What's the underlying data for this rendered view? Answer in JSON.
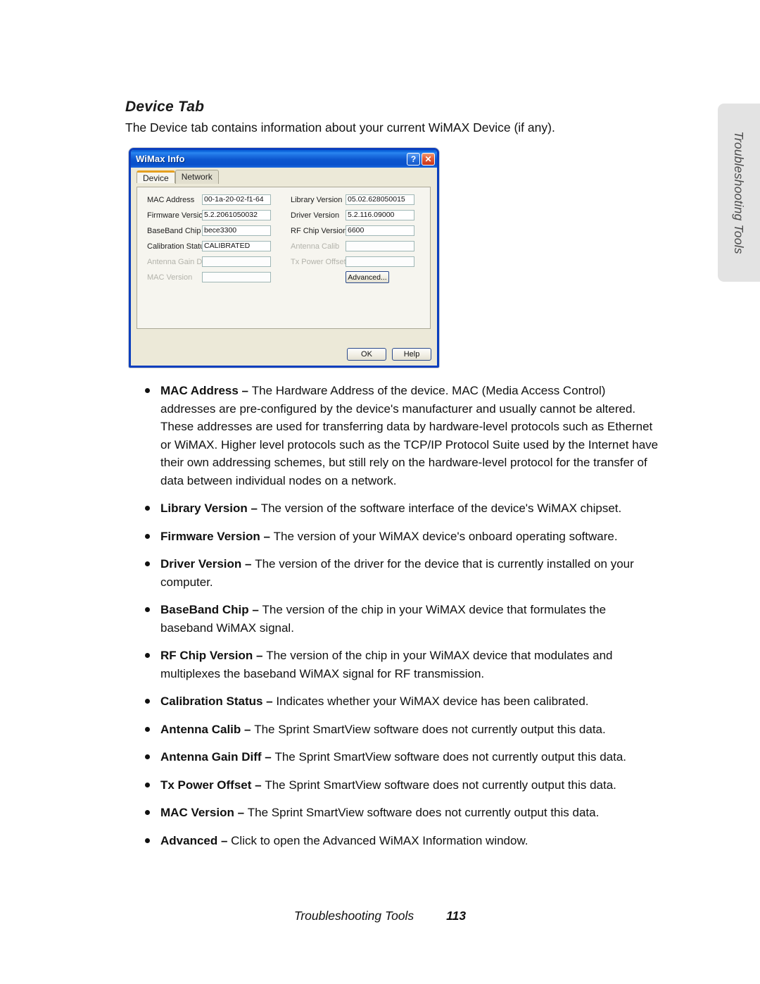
{
  "page": {
    "section_title": "Device Tab",
    "intro": "The Device tab contains information about your current WiMAX Device (if any).",
    "side_tab_label": "Troubleshooting Tools",
    "footer_chapter": "Troubleshooting Tools",
    "footer_page": "113"
  },
  "dialog": {
    "title": "WiMax Info",
    "help_button": "?",
    "close_button": "✕",
    "tabs": [
      {
        "label": "Device",
        "active": true
      },
      {
        "label": "Network",
        "active": false
      }
    ],
    "fields_left": [
      {
        "label": "MAC Address",
        "value": "00-1a-20-02-f1-64",
        "disabled": false
      },
      {
        "label": "Firmware Version",
        "value": "5.2.2061050032",
        "disabled": false
      },
      {
        "label": "BaseBand Chip",
        "value": "bece3300",
        "disabled": false
      },
      {
        "label": "Calibration Status",
        "value": "CALIBRATED",
        "disabled": false
      },
      {
        "label": "Antenna Gain Diff",
        "value": "",
        "disabled": true
      },
      {
        "label": "MAC Version",
        "value": "",
        "disabled": true
      }
    ],
    "fields_right": [
      {
        "label": "Library Version",
        "value": "05.02.628050015",
        "disabled": false
      },
      {
        "label": "Driver Version",
        "value": "5.2.116.09000",
        "disabled": false
      },
      {
        "label": "RF Chip Version",
        "value": "6600",
        "disabled": false
      },
      {
        "label": "Antenna Calib",
        "value": "",
        "disabled": true
      },
      {
        "label": "Tx Power Offset",
        "value": "",
        "disabled": true
      }
    ],
    "advanced_button": "Advanced...",
    "ok_button": "OK",
    "help_footer_button": "Help"
  },
  "bullets": [
    {
      "term": "MAC Address – ",
      "text": "The Hardware Address of the device. MAC (Media Access Control) addresses are pre-configured by the device's manufacturer and usually cannot be altered. These addresses are used for transferring data by hardware-level protocols such as Ethernet or WiMAX. Higher level protocols such as the TCP/IP Protocol Suite used by the Internet have their own addressing schemes, but still rely on the hardware-level protocol for the transfer of data between individual nodes on a network."
    },
    {
      "term": "Library Version – ",
      "text": "The version of the software interface of the device's WiMAX chipset."
    },
    {
      "term": "Firmware Version – ",
      "text": "The version of your WiMAX device's onboard operating software."
    },
    {
      "term": "Driver Version – ",
      "text": "The version of the driver for the device that is currently installed on your computer."
    },
    {
      "term": "BaseBand Chip – ",
      "text": "The version of the chip in your WiMAX device that formulates the baseband WiMAX signal."
    },
    {
      "term": "RF Chip Version – ",
      "text": "The version of the chip in your WiMAX device that modulates and multiplexes the baseband WiMAX signal for RF transmission."
    },
    {
      "term": "Calibration Status – ",
      "text": "Indicates whether your WiMAX device has been calibrated."
    },
    {
      "term": "Antenna Calib – ",
      "text": "The Sprint SmartView software does not currently output this data."
    },
    {
      "term": "Antenna Gain Diff – ",
      "text": "The Sprint SmartView software does not currently output this data."
    },
    {
      "term": "Tx Power Offset – ",
      "text": "The Sprint SmartView software does not currently output this data."
    },
    {
      "term": "MAC Version – ",
      "text": "The Sprint SmartView software does not currently output this data."
    },
    {
      "term": "Advanced – ",
      "text": "Click to open the Advanced WiMAX Information window."
    }
  ],
  "colors": {
    "titlebar_blue": "#0d64dc",
    "dialog_border": "#0b3fbe",
    "dialog_face": "#ece9d8",
    "panel_face": "#f6f5ef",
    "active_tab_accent": "#e5a020",
    "side_tab_gray": "#e3e3e3",
    "close_button_red": "#e4603a"
  }
}
